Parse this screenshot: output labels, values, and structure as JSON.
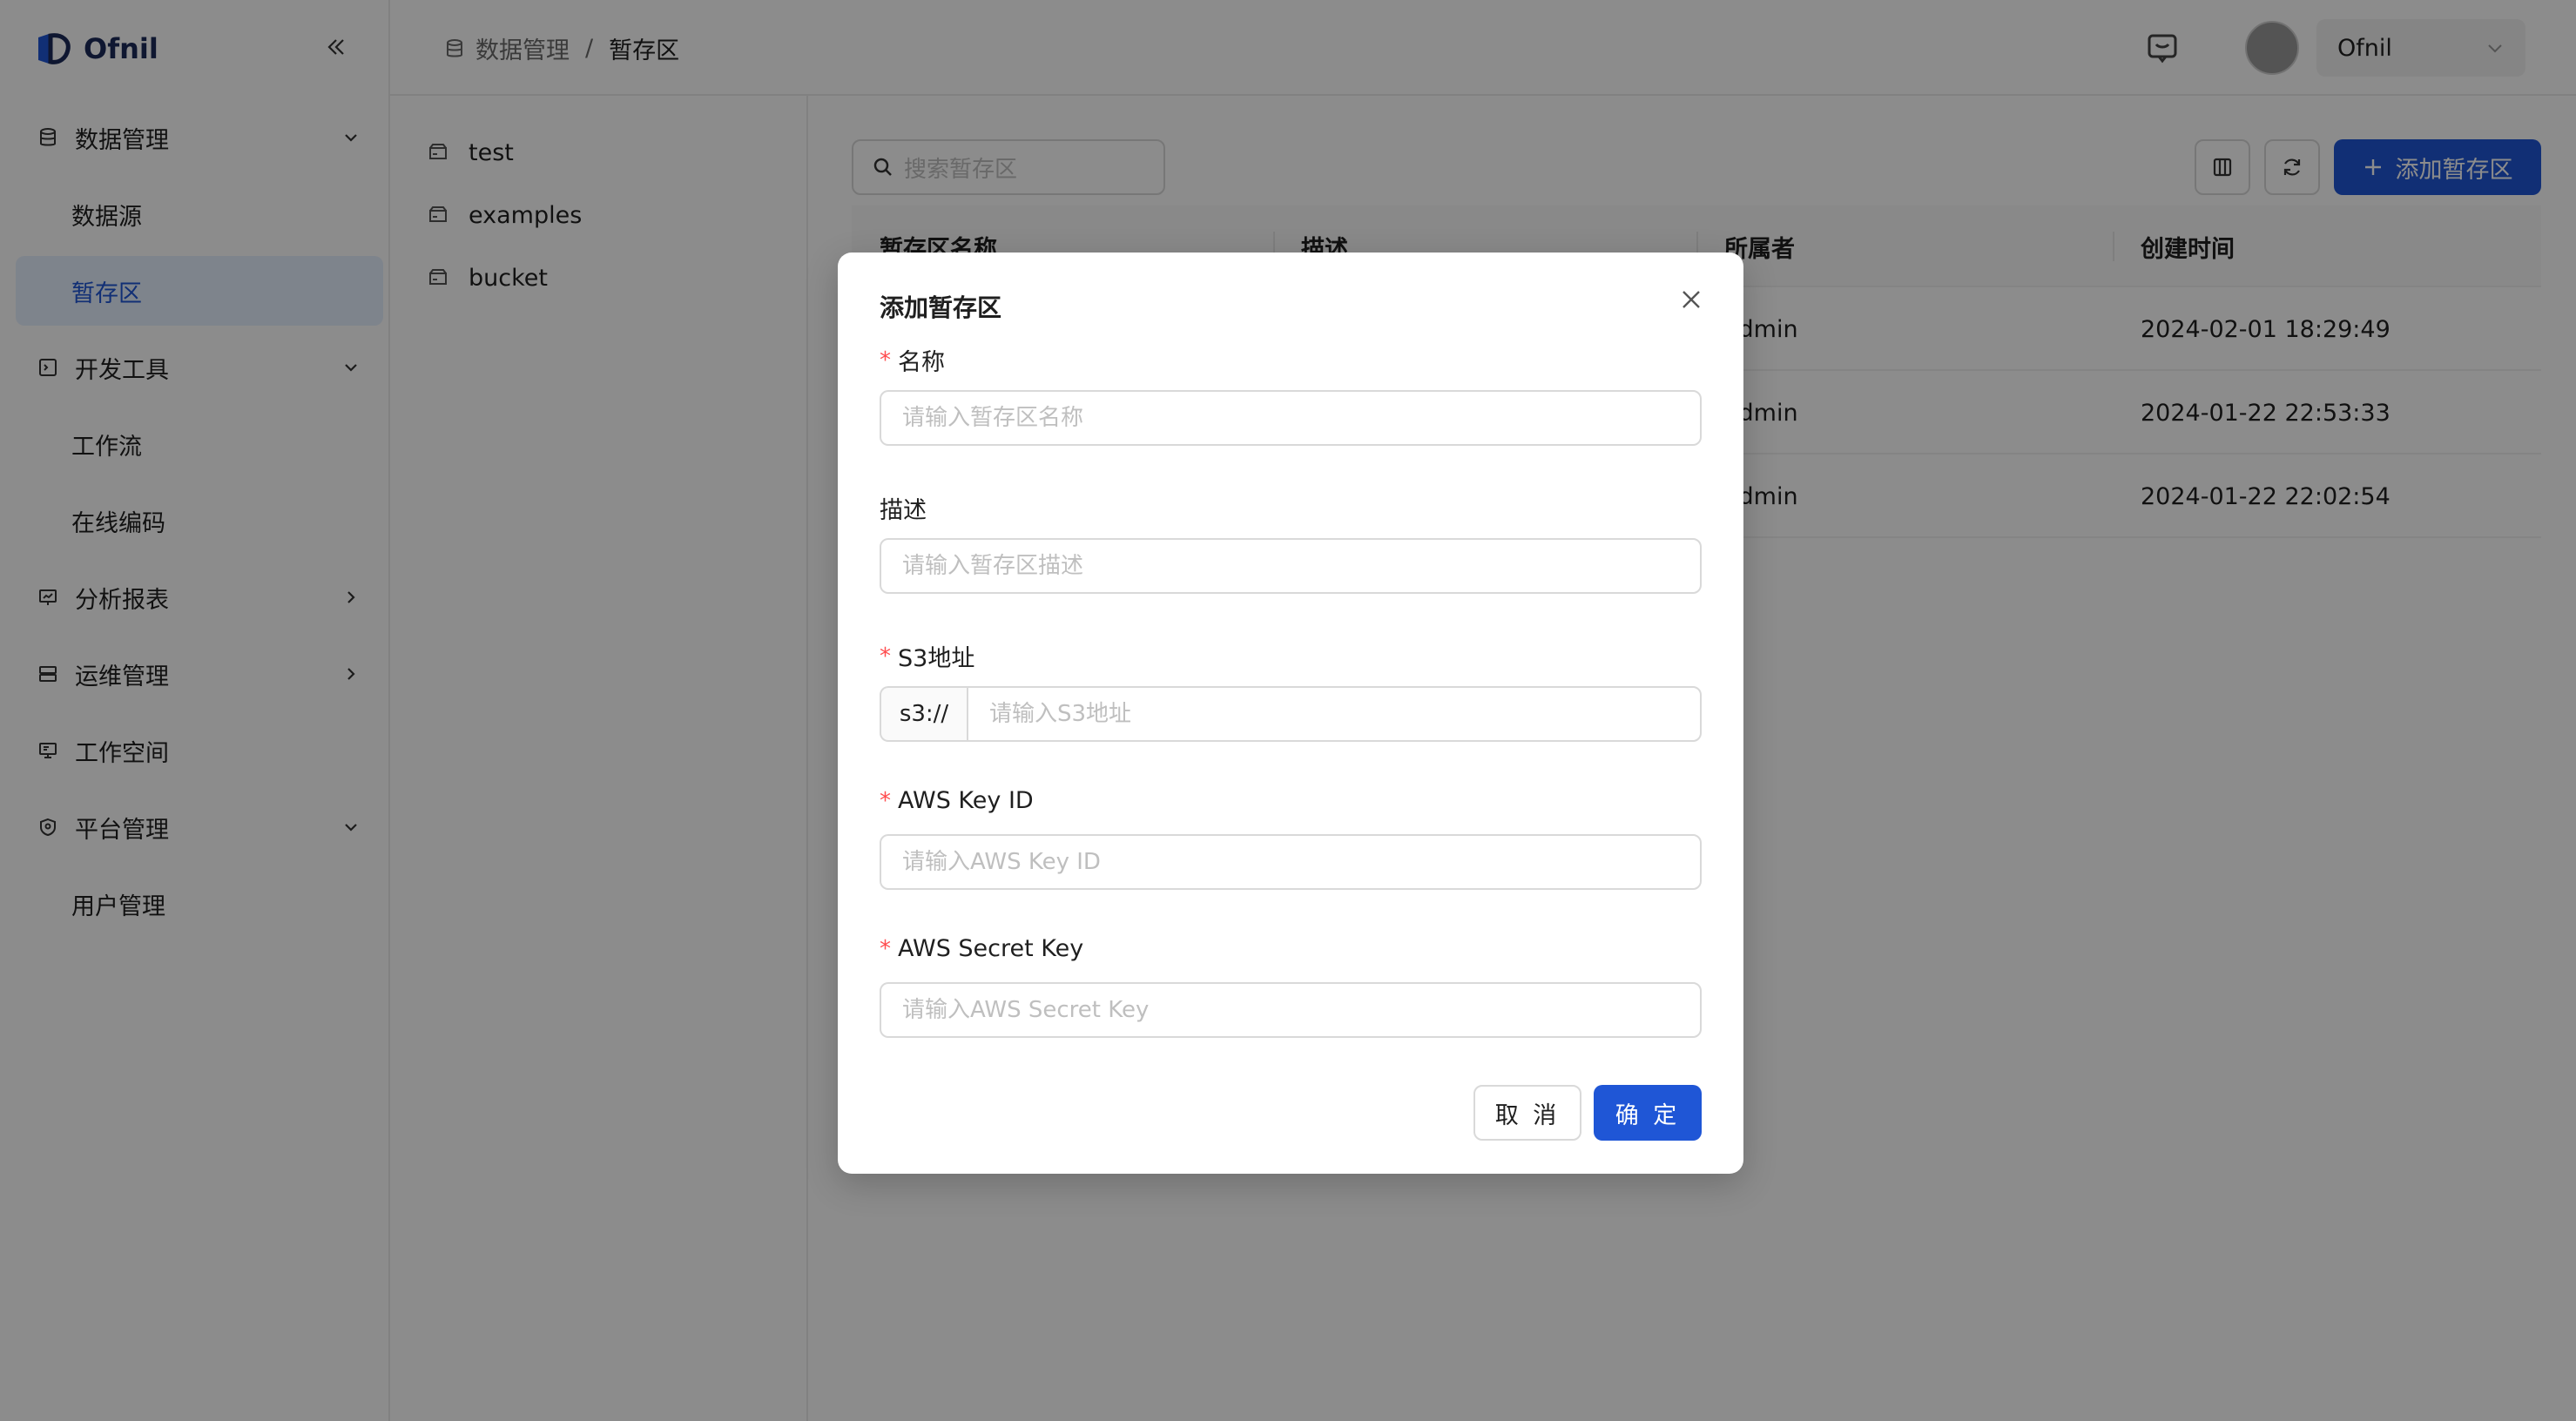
{
  "brand": {
    "name": "Ofnil"
  },
  "sidebar": {
    "items": [
      {
        "label": "数据管理",
        "icon": "database-icon",
        "expand": "chevron-down-icon"
      },
      {
        "label": "数据源",
        "sub": true
      },
      {
        "label": "暂存区",
        "sub": true,
        "active": true
      },
      {
        "label": "开发工具",
        "icon": "terminal-icon",
        "expand": "chevron-down-icon"
      },
      {
        "label": "工作流",
        "sub": true
      },
      {
        "label": "在线编码",
        "sub": true
      },
      {
        "label": "分析报表",
        "icon": "report-icon",
        "expand": "chevron-right-icon"
      },
      {
        "label": "运维管理",
        "icon": "ops-icon",
        "expand": "chevron-right-icon"
      },
      {
        "label": "工作空间",
        "icon": "monitor-icon"
      },
      {
        "label": "平台管理",
        "icon": "shield-icon",
        "expand": "chevron-down-icon"
      },
      {
        "label": "用户管理",
        "sub": true
      }
    ]
  },
  "header": {
    "breadcrumb_parent": "数据管理",
    "breadcrumb_sep": "/",
    "breadcrumb_current": "暂存区",
    "user_name": "Ofnil"
  },
  "tree": {
    "items": [
      {
        "label": "test"
      },
      {
        "label": "examples"
      },
      {
        "label": "bucket"
      }
    ]
  },
  "main": {
    "search_placeholder": "搜索暂存区",
    "add_label": "添加暂存区",
    "columns": [
      "暂存区名称",
      "描述",
      "所属者",
      "创建时间"
    ],
    "rows": [
      {
        "owner": "admin",
        "created": "2024-02-01 18:29:49"
      },
      {
        "owner": "admin",
        "created": "2024-01-22 22:53:33"
      },
      {
        "owner": "admin",
        "created": "2024-01-22 22:02:54"
      }
    ]
  },
  "modal": {
    "title": "添加暂存区",
    "fields": {
      "name": {
        "label": "名称",
        "placeholder": "请输入暂存区名称",
        "required": true
      },
      "desc": {
        "label": "描述",
        "placeholder": "请输入暂存区描述",
        "required": false
      },
      "s3": {
        "label": "S3地址",
        "prefix": "s3://",
        "placeholder": "请输入S3地址",
        "required": true
      },
      "key_id": {
        "label": "AWS Key ID",
        "placeholder": "请输入AWS Key ID",
        "required": true
      },
      "secret": {
        "label": "AWS Secret Key",
        "placeholder": "请输入AWS Secret Key",
        "required": true
      }
    },
    "required_mark": "*",
    "cancel_label": "取 消",
    "ok_label": "确 定"
  },
  "colors": {
    "accent": "#1f56d6",
    "active_bg": "#e6f0ff",
    "required": "#ff4d4f"
  }
}
